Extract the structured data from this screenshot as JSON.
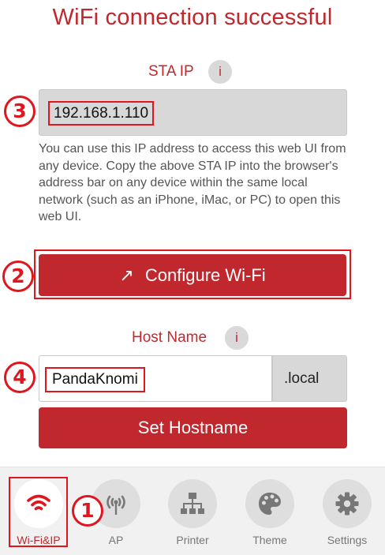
{
  "page": {
    "title": "WiFi connection successful"
  },
  "sta": {
    "label": "STA IP",
    "info_icon": "i",
    "value": "192.168.1.110",
    "help_text": "You can use this IP address to access this web UI from any device. Copy the above STA IP into the browser's address bar on any device within the same local network (such as an iPhone, iMac, or PC) to open this web UI."
  },
  "configure": {
    "icon": "↗",
    "label": "Configure Wi-Fi"
  },
  "hostname": {
    "label": "Host Name",
    "info_icon": "i",
    "value": "PandaKnomi",
    "suffix": ".local",
    "set_label": "Set Hostname"
  },
  "callouts": [
    "1",
    "2",
    "3",
    "4"
  ],
  "nav": {
    "items": [
      {
        "label": "Wi-Fi&IP",
        "icon": "wifi-icon",
        "active": true
      },
      {
        "label": "AP",
        "icon": "access-point-icon",
        "active": false
      },
      {
        "label": "Printer",
        "icon": "network-tree-icon",
        "active": false
      },
      {
        "label": "Theme",
        "icon": "palette-icon",
        "active": false
      },
      {
        "label": "Settings",
        "icon": "gear-icon",
        "active": false
      }
    ]
  },
  "colors": {
    "accent": "#c0282e",
    "annotation": "#e0161e",
    "field_bg": "#d8d8d8",
    "nav_bg": "#f1f1f1"
  }
}
